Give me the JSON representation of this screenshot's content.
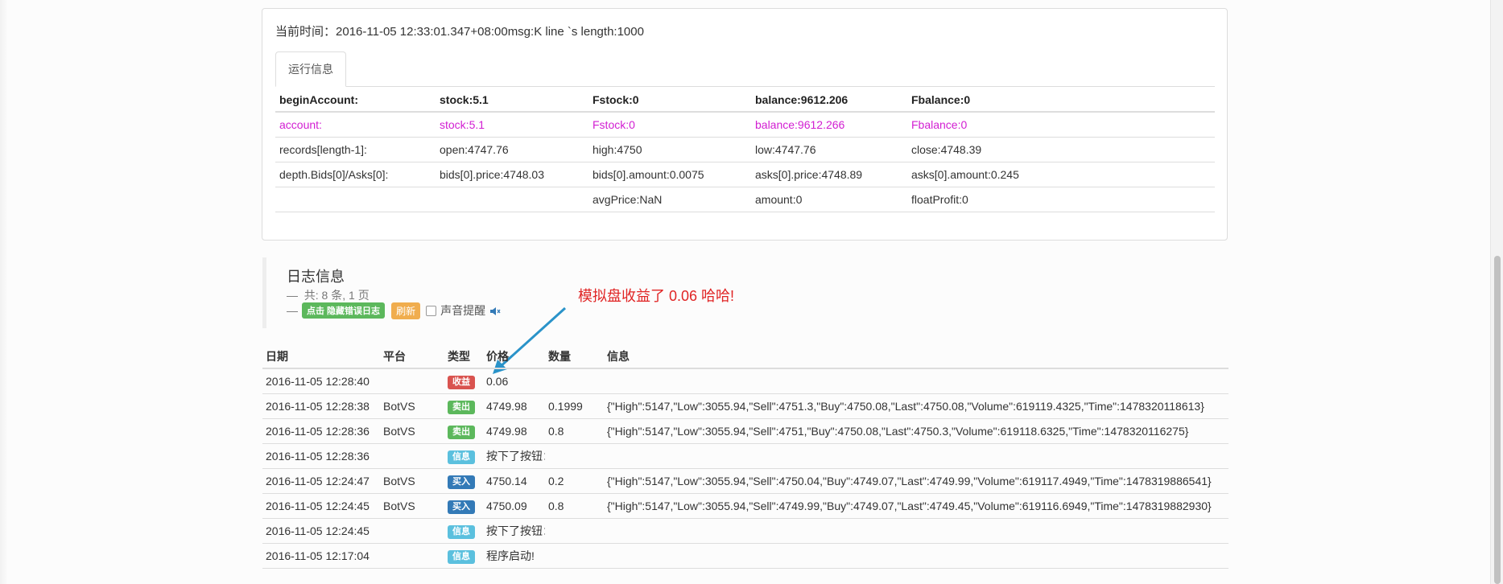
{
  "status": {
    "label": "当前时间：",
    "time": "2016-11-05 12:33:01.347+08:00",
    "msg": "msg:K line `s length:1000"
  },
  "tabs": [
    {
      "label": "运行信息"
    }
  ],
  "run_table": {
    "header": [
      "beginAccount:",
      "stock:5.1",
      "Fstock:0",
      "balance:9612.206",
      "Fbalance:0"
    ],
    "rows": [
      [
        "account:",
        "stock:5.1",
        "Fstock:0",
        "balance:9612.266",
        "Fbalance:0"
      ],
      [
        "records[length-1]:",
        "open:4747.76",
        "high:4750",
        "low:4747.76",
        "close:4748.39"
      ],
      [
        "depth.Bids[0]/Asks[0]:",
        "bids[0].price:4748.03",
        "bids[0].amount:0.0075",
        "asks[0].price:4748.89",
        "asks[0].amount:0.245"
      ],
      [
        "",
        "",
        "avgPrice:NaN",
        "amount:0",
        "floatProfit:0"
      ]
    ],
    "account_color": "#d21ed2"
  },
  "log": {
    "title": "日志信息",
    "count": "共: 8 条, 1 页",
    "dash": "—",
    "hide_button": "点击 隐藏错误日志",
    "refresh_button": "刷新",
    "sound_label": "声音提醒",
    "speaker_icon": "speaker-icon"
  },
  "annotation": "模拟盘收益了 0.06 哈哈!",
  "log_table": {
    "headers": [
      "日期",
      "平台",
      "类型",
      "价格",
      "数量",
      "信息"
    ],
    "rows": [
      {
        "date": "2016-11-05 12:28:40",
        "platform": "",
        "type": "收益",
        "type_color": "#d9534f",
        "price": "0.06",
        "amount": "",
        "info": ""
      },
      {
        "date": "2016-11-05 12:28:38",
        "platform": "BotVS",
        "type": "卖出",
        "type_color": "#5cb85c",
        "price": "4749.98",
        "amount": "0.1999",
        "info": "{\"High\":5147,\"Low\":3055.94,\"Sell\":4751.3,\"Buy\":4750.08,\"Last\":4750.08,\"Volume\":619119.4325,\"Time\":1478320118613}"
      },
      {
        "date": "2016-11-05 12:28:36",
        "platform": "BotVS",
        "type": "卖出",
        "type_color": "#5cb85c",
        "price": "4749.98",
        "amount": "0.8",
        "info": "{\"High\":5147,\"Low\":3055.94,\"Sell\":4751,\"Buy\":4750.08,\"Last\":4750.3,\"Volume\":619118.6325,\"Time\":1478320116275}"
      },
      {
        "date": "2016-11-05 12:28:36",
        "platform": "",
        "type": "信息",
        "type_color": "#5bc0de",
        "price": "按下了按钮： cmdCover",
        "amount": "",
        "info": ""
      },
      {
        "date": "2016-11-05 12:24:47",
        "platform": "BotVS",
        "type": "买入",
        "type_color": "#337ab7",
        "price": "4750.14",
        "amount": "0.2",
        "info": "{\"High\":5147,\"Low\":3055.94,\"Sell\":4750.04,\"Buy\":4749.07,\"Last\":4749.99,\"Volume\":619117.4949,\"Time\":1478319886541}"
      },
      {
        "date": "2016-11-05 12:24:45",
        "platform": "BotVS",
        "type": "买入",
        "type_color": "#337ab7",
        "price": "4750.09",
        "amount": "0.8",
        "info": "{\"High\":5147,\"Low\":3055.94,\"Sell\":4749.99,\"Buy\":4749.07,\"Last\":4749.45,\"Volume\":619116.6949,\"Time\":1478319882930}"
      },
      {
        "date": "2016-11-05 12:24:45",
        "platform": "",
        "type": "信息",
        "type_color": "#5bc0de",
        "price": "按下了按钮： cmdOpen",
        "amount": "",
        "info": ""
      },
      {
        "date": "2016-11-05 12:17:04",
        "platform": "",
        "type": "信息",
        "type_color": "#5bc0de",
        "price": "程序启动!",
        "amount": "",
        "info": ""
      }
    ]
  },
  "colors": {
    "annotation": "#e02424",
    "arrow": "#2a93c9"
  }
}
